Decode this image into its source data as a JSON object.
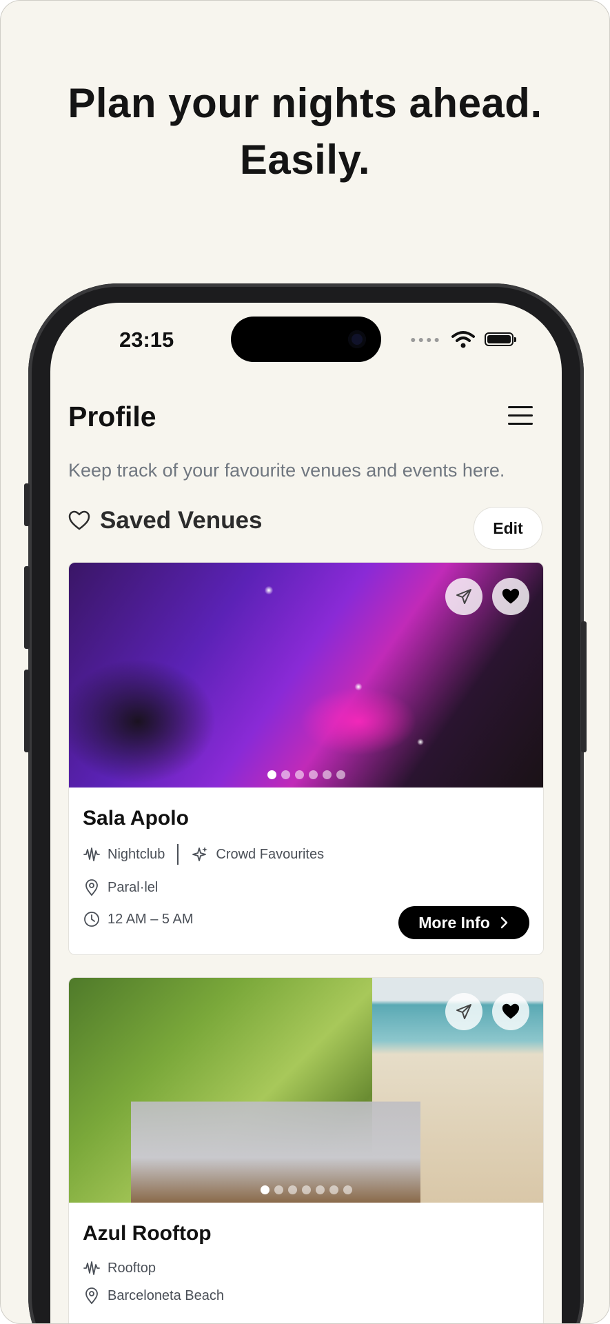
{
  "headline": {
    "line1": "Plan your nights ahead.",
    "line2": "Easily."
  },
  "status_bar": {
    "time": "23:15"
  },
  "page": {
    "title": "Profile",
    "subtitle": "Keep track of your favourite venues and events here."
  },
  "saved_section": {
    "title": "Saved Venues",
    "edit_label": "Edit"
  },
  "venues": [
    {
      "name": "Sala Apolo",
      "type": "Nightclub",
      "tag": "Crowd Favourites",
      "location": "Paral·lel",
      "hours": "12 AM – 5 AM",
      "more_label": "More Info",
      "photo_count": 6,
      "photo_index": 1
    },
    {
      "name": "Azul Rooftop",
      "type": "Rooftop",
      "location": "Barceloneta Beach",
      "photo_count": 7,
      "photo_index": 1
    }
  ],
  "icons": {
    "menu": "hamburger-icon",
    "heart_outline": "heart-outline-icon",
    "share": "send-icon",
    "favorite": "heart-filled-icon",
    "venue_type": "waveform-icon",
    "tag": "sparkles-icon",
    "location": "map-pin-icon",
    "hours": "clock-icon",
    "more": "chevron-right-icon"
  },
  "colors": {
    "background": "#f7f5ee",
    "accent": "#000000",
    "muted_text": "#707780"
  }
}
